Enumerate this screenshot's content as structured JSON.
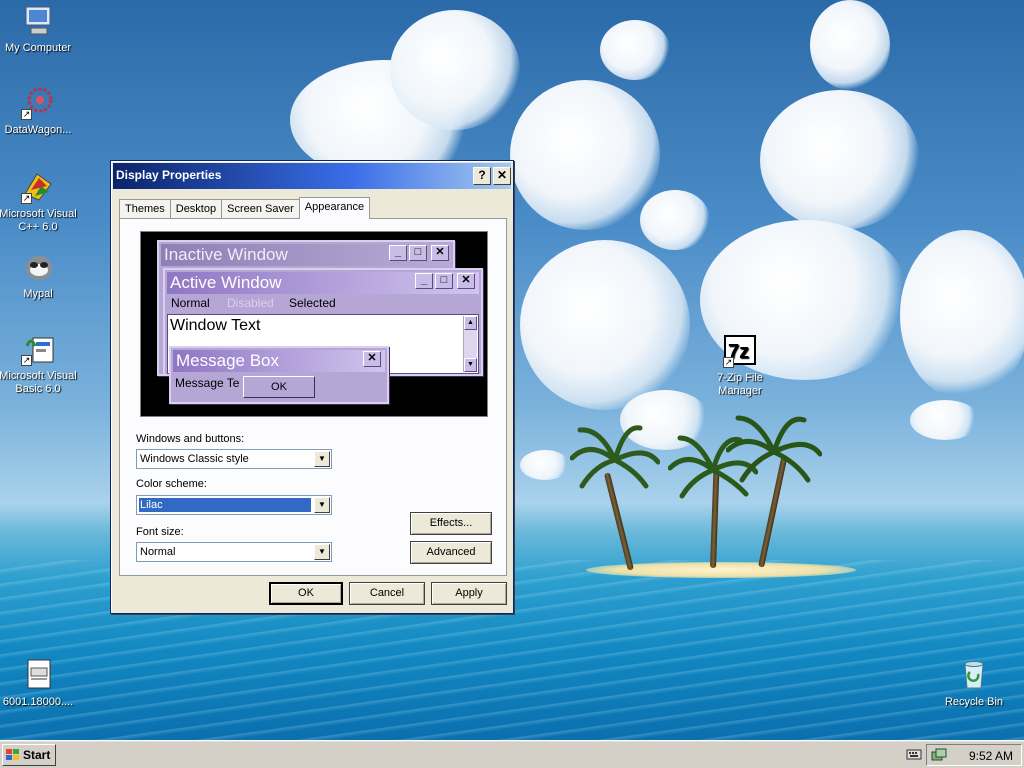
{
  "desktop": {
    "icons": [
      {
        "label": "My Computer",
        "icon": "computer-icon"
      },
      {
        "label": "DataWagon...",
        "icon": "datawagon-icon"
      },
      {
        "label": "Microsoft Visual C++ 6.0",
        "icon": "visual-cpp-icon"
      },
      {
        "label": "Mypal",
        "icon": "mypal-icon"
      },
      {
        "label": "Microsoft Visual Basic 6.0",
        "icon": "visual-basic-icon"
      },
      {
        "label": "6001.18000....",
        "icon": "file-icon"
      },
      {
        "label": "7-Zip File Manager",
        "icon": "7zip-icon"
      },
      {
        "label": "Recycle Bin",
        "icon": "recycle-bin-icon"
      }
    ]
  },
  "dialog": {
    "title": "Display Properties",
    "help_label": "?",
    "close_label": "✕",
    "tabs": [
      "Themes",
      "Desktop",
      "Screen Saver",
      "Appearance"
    ],
    "active_tab": "Appearance",
    "preview": {
      "inactive_title": "Inactive Window",
      "active_title": "Active Window",
      "menu_normal": "Normal",
      "menu_disabled": "Disabled",
      "menu_selected": "Selected",
      "window_text": "Window Text",
      "message_box_title": "Message Box",
      "message_text": "Message Te",
      "ok_label": "OK",
      "min_glyph": "_",
      "max_glyph": "□",
      "close_glyph": "✕",
      "scroll_up": "▲",
      "scroll_down": "▼"
    },
    "windows_buttons_label": "Windows and buttons:",
    "windows_buttons_value": "Windows Classic style",
    "color_scheme_label": "Color scheme:",
    "color_scheme_value": "Lilac",
    "font_size_label": "Font size:",
    "font_size_value": "Normal",
    "effects_label": "Effects...",
    "advanced_label": "Advanced",
    "ok_label": "OK",
    "cancel_label": "Cancel",
    "apply_label": "Apply"
  },
  "taskbar": {
    "start_label": "Start",
    "clock": "9:52 AM"
  },
  "colors": {
    "titlebar_start": "#0a246a",
    "lilac_active": "#8f76c4",
    "lilac_face": "#b5a6d6",
    "selection": "#316ac5"
  }
}
